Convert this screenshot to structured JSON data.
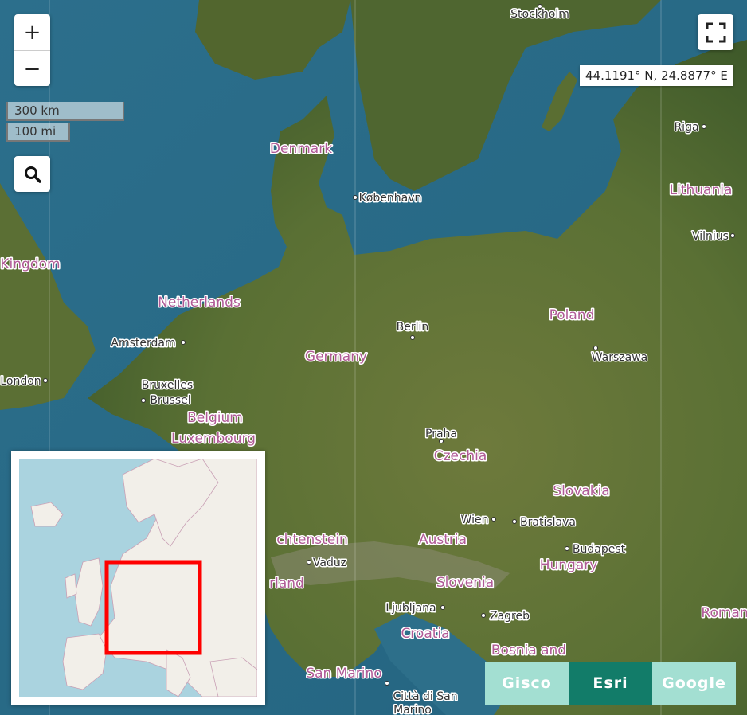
{
  "zoom": {
    "in_label": "+",
    "out_label": "−"
  },
  "scale": {
    "km": "300 km",
    "mi": "100 mi"
  },
  "coordinates": "44.1191° N, 24.8877° E",
  "icons": {
    "search": "search-icon",
    "fullscreen": "fullscreen-icon"
  },
  "labels": {
    "stockholm": "Stockholm",
    "denmark": "Denmark",
    "kobenhavn": "København",
    "riga": "Riga",
    "lithuania": "Lithuania",
    "vilnius": "Vilnius",
    "kingdom": "Kingdom",
    "netherlands": "Netherlands",
    "amsterdam": "Amsterdam",
    "berlin": "Berlin",
    "poland": "Poland",
    "germany": "Germany",
    "warszawa": "Warszawa",
    "london": "London",
    "bruxelles": "Bruxelles",
    "brussel": "Brussel",
    "belgium": "Belgium",
    "luxembourg": "Luxembourg",
    "praha": "Praha",
    "czechia": "Czechia",
    "slovakia": "Slovakia",
    "wien": "Wien",
    "bratislava": "Bratislava",
    "liechtenstein": "chtenstein",
    "austria": "Austria",
    "budapest": "Budapest",
    "vaduz": "Vaduz",
    "switzerland": "rland",
    "hungary": "Hungary",
    "slovenia": "Slovenia",
    "ljubljana": "Ljubljana",
    "zagreb": "Zagreb",
    "romania": "Roman",
    "croatia": "Croatia",
    "bosnia": "Bosnia and",
    "sanmarino": "San Marino",
    "cittadisan": "Città di San",
    "marino": "Marino"
  },
  "layers": [
    {
      "label": "Gisco",
      "active": false
    },
    {
      "label": "Esri",
      "active": true
    },
    {
      "label": "Google",
      "active": false
    }
  ],
  "colors": {
    "active_layer": "#127c69",
    "inactive_layer": "#a3dfd2",
    "overview_box": "#ff0000"
  }
}
